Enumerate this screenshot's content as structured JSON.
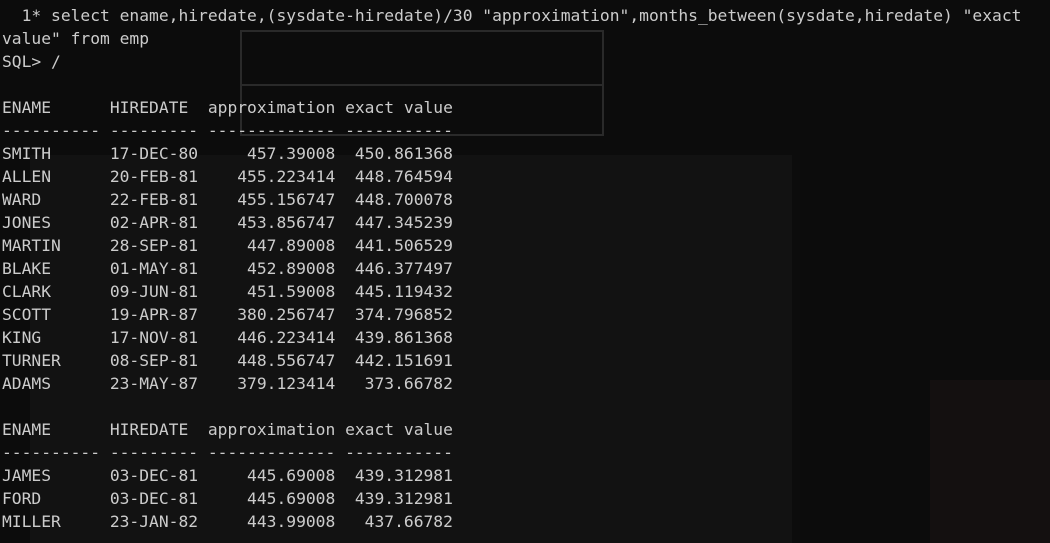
{
  "lines": [
    "  1* select ename,hiredate,(sysdate-hiredate)/30 \"approximation\",months_between(sysdate,hiredate) \"exact",
    "value\" from emp",
    "SQL> /",
    "",
    "ENAME      HIREDATE  approximation exact value",
    "---------- --------- ------------- -----------",
    "SMITH      17-DEC-80     457.39008  450.861368",
    "ALLEN      20-FEB-81    455.223414  448.764594",
    "WARD       22-FEB-81    455.156747  448.700078",
    "JONES      02-APR-81    453.856747  447.345239",
    "MARTIN     28-SEP-81     447.89008  441.506529",
    "BLAKE      01-MAY-81     452.89008  446.377497",
    "CLARK      09-JUN-81     451.59008  445.119432",
    "SCOTT      19-APR-87    380.256747  374.796852",
    "KING       17-NOV-81    446.223414  439.861368",
    "TURNER     08-SEP-81    448.556747  442.151691",
    "ADAMS      23-MAY-87    379.123414   373.66782",
    "",
    "ENAME      HIREDATE  approximation exact value",
    "---------- --------- ------------- -----------",
    "JAMES      03-DEC-81     445.69008  439.312981",
    "FORD       03-DEC-81     445.69008  439.312981",
    "MILLER     23-JAN-82     443.99008   437.66782"
  ]
}
